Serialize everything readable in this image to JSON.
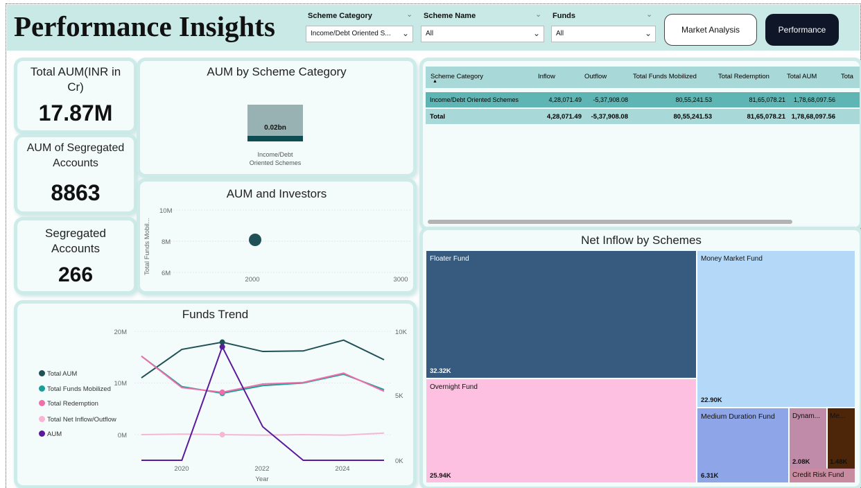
{
  "header": {
    "title": "Performance Insights",
    "slicers": [
      {
        "label": "Scheme Category",
        "value": "Income/Debt Oriented S..."
      },
      {
        "label": "Scheme Name",
        "value": "All"
      },
      {
        "label": "Funds",
        "value": "All"
      }
    ],
    "buttons": {
      "market_analysis": "Market Analysis",
      "performance": "Performance"
    }
  },
  "kpis": {
    "total_aum": {
      "label": "Total AUM(INR in Cr)",
      "value": "17.87M"
    },
    "aum_segregated": {
      "label": "AUM of Segregated Accounts",
      "value": "8863"
    },
    "segregated_accounts": {
      "label": "Segregated Accounts",
      "value": "266"
    }
  },
  "aum_by_category": {
    "title": "AUM by Scheme Category",
    "bar_value_label": "0.02bn",
    "category_label_line1": "Income/Debt",
    "category_label_line2": "Oriented Schemes"
  },
  "aum_investors": {
    "title": "AUM and Investors",
    "y_axis_label": "Total Funds Mobil...",
    "y_ticks": [
      "10M",
      "8M",
      "6M"
    ],
    "x_ticks": [
      "2000",
      "3000"
    ]
  },
  "funds_trend": {
    "title": "Funds Trend",
    "x_axis_label": "Year",
    "left_ticks": [
      "20M",
      "10M",
      "0M"
    ],
    "right_ticks": [
      "10K",
      "5K",
      "0K"
    ],
    "x_ticks": [
      "2020",
      "2022",
      "2024"
    ],
    "legend": [
      {
        "name": "Total AUM",
        "color": "#1f5156"
      },
      {
        "name": "Total Funds Mobilized",
        "color": "#1a9e99"
      },
      {
        "name": "Total Redemption",
        "color": "#f06ea9"
      },
      {
        "name": "Total Net Inflow/Outflow",
        "color": "#f7b7d3"
      },
      {
        "name": "AUM",
        "color": "#5b1a9c"
      }
    ]
  },
  "table": {
    "columns": [
      "Scheme Category",
      "Inflow",
      "Outflow",
      "Total Funds Mobilized",
      "Total Redemption",
      "Total AUM",
      "Tota"
    ],
    "rows": [
      [
        "Income/Debt Oriented Schemes",
        "4,28,071.49",
        "-5,37,908.08",
        "80,55,241.53",
        "81,65,078.21",
        "1,78,68,097.56"
      ]
    ],
    "total": [
      "Total",
      "4,28,071.49",
      "-5,37,908.08",
      "80,55,241.53",
      "81,65,078.21",
      "1,78,68,097.56"
    ]
  },
  "treemap": {
    "title": "Net Inflow by Schemes",
    "cells": [
      {
        "name": "Floater Fund",
        "value": "32.32K"
      },
      {
        "name": "Money Market Fund",
        "value": "22.90K"
      },
      {
        "name": "Overnight Fund",
        "value": "25.94K"
      },
      {
        "name": "Medium Duration Fund",
        "value": "6.31K"
      },
      {
        "name": "Dynam...",
        "value": "2.08K"
      },
      {
        "name": "Me...",
        "value": "1.48K"
      },
      {
        "name": "Credit Risk Fund",
        "value": ""
      }
    ]
  },
  "chart_data": [
    {
      "type": "bar",
      "title": "AUM by Scheme Category",
      "categories": [
        "Income/Debt Oriented Schemes"
      ],
      "values": [
        0.02
      ],
      "data_labels": [
        "0.02bn"
      ]
    },
    {
      "type": "scatter",
      "title": "AUM and Investors",
      "ylabel": "Total Funds Mobil...",
      "xlim": [
        1500,
        3000
      ],
      "ylim": [
        6000000,
        10000000
      ],
      "points": [
        {
          "x": 2030,
          "y": 8100000
        }
      ]
    },
    {
      "type": "line",
      "title": "Funds Trend",
      "xlabel": "Year",
      "x": [
        2019,
        2020,
        2021,
        2022,
        2023,
        2024,
        2025
      ],
      "ylim_left": [
        0,
        20000000
      ],
      "ylim_right": [
        0,
        10000
      ],
      "series": [
        {
          "name": "Total AUM",
          "axis": "left",
          "values": [
            11000000,
            16500000,
            17900000,
            16100000,
            16200000,
            18300000,
            14500000
          ]
        },
        {
          "name": "Total Funds Mobilized",
          "axis": "left",
          "values": [
            15200000,
            9300000,
            8000000,
            9500000,
            10000000,
            11700000,
            8700000
          ]
        },
        {
          "name": "Total Redemption",
          "axis": "left",
          "values": [
            15200000,
            9100000,
            8200000,
            9800000,
            10100000,
            11900000,
            8400000
          ]
        },
        {
          "name": "Total Net Inflow/Outflow",
          "axis": "left",
          "values": [
            0,
            100000,
            0,
            -100000,
            0,
            -100000,
            300000
          ]
        },
        {
          "name": "AUM",
          "axis": "right",
          "values": [
            0,
            0,
            8800,
            2600,
            0,
            0,
            0
          ]
        }
      ]
    },
    {
      "type": "treemap",
      "title": "Net Inflow by Schemes",
      "categories": [
        "Floater Fund",
        "Money Market Fund",
        "Overnight Fund",
        "Medium Duration Fund",
        "Dynam...",
        "Me...",
        "Credit Risk Fund"
      ],
      "values": [
        32320,
        22900,
        25940,
        6310,
        2080,
        1480,
        null
      ]
    }
  ]
}
